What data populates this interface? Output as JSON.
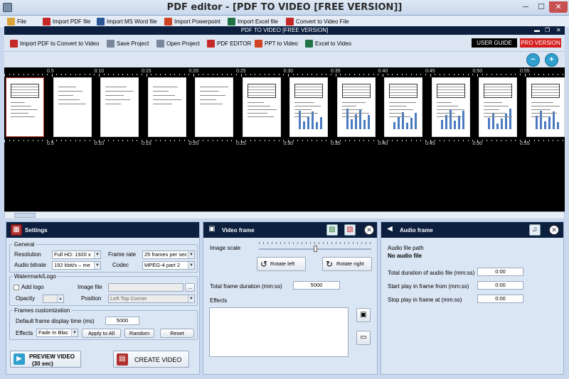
{
  "window": {
    "title": "PDF editor - [PDF TO VIDEO [FREE VERSION]]",
    "controls": {
      "minimize": "─",
      "maximize": "☐",
      "close": "✕"
    }
  },
  "menu": {
    "items": [
      {
        "label": "File",
        "icon": "folder-icon",
        "color": "#d9a53a"
      },
      {
        "label": "Import PDF file",
        "icon": "pdf-icon",
        "color": "#c62828"
      },
      {
        "label": "Import MS Word file",
        "icon": "word-icon",
        "color": "#2b5797"
      },
      {
        "label": "Import Powerpoint",
        "icon": "powerpoint-icon",
        "color": "#d04423"
      },
      {
        "label": "Import Excel file",
        "icon": "excel-icon",
        "color": "#217346"
      },
      {
        "label": "Convert to Video File",
        "icon": "video-file-icon",
        "color": "#c62828"
      }
    ]
  },
  "inner": {
    "title": "PDF TO VIDEO [FREE VERSION]",
    "controls": {
      "minimize": "▬",
      "restore": "❐",
      "close": "✕"
    }
  },
  "toolbar": {
    "items": [
      {
        "label": "Import PDF to Convert to Video",
        "icon": "import-icon",
        "color": "#c62828"
      },
      {
        "label": "Save Project",
        "icon": "save-icon",
        "color": "#7a8699"
      },
      {
        "label": "Open Project",
        "icon": "open-icon",
        "color": "#7a8699"
      },
      {
        "label": "PDF EDITOR",
        "icon": "pdf-editor-icon",
        "color": "#c62828"
      },
      {
        "label": "PPT to Video",
        "icon": "ppt-icon",
        "color": "#d04423"
      },
      {
        "label": "Excel to Video",
        "icon": "excel-icon",
        "color": "#217346"
      }
    ],
    "user_guide": "USER GUIDE",
    "pro_version": "PRO VERSION"
  },
  "timeline": {
    "ticks": [
      "0:05",
      "0:10",
      "0:15",
      "0:20",
      "0:25",
      "0:30",
      "0:35",
      "0:40",
      "0:45",
      "0:50",
      "0:55"
    ],
    "tick_labels": [
      "0.5",
      "0:10",
      "0:15",
      "0:20",
      "0:25",
      "0:30",
      "0:35",
      "0:40",
      "0:45",
      "0:50",
      "0:55"
    ]
  },
  "settings": {
    "title": "Settings",
    "general": {
      "title": "General",
      "resolution_label": "Resolution",
      "resolution_value": "Full HD: 1920 x",
      "frame_rate_label": "Frame rate",
      "frame_rate_value": "25 frames per sec",
      "audio_bitrate_label": "Audio bitrate",
      "audio_bitrate_value": "192 kbit/s – me",
      "codec_label": "Codec",
      "codec_value": "MPEG-4 part 2"
    },
    "watermark": {
      "title": "Watermark/Logo",
      "add_logo_label": "Add logo",
      "image_file_label": "Image file",
      "opacity_label": "Opacity",
      "position_label": "Position",
      "position_value": "Left Top Corner",
      "browse_label": "..."
    },
    "frames": {
      "title": "Frames customization",
      "display_time_label": "Default frame display time (ms)",
      "display_time_value": "5000",
      "effects_label": "Effects",
      "effects_value": "Fade In Blac",
      "apply_all_label": "Apply to All",
      "random_label": "Random",
      "reset_label": "Reset"
    },
    "preview_label": "PREVIEW VIDEO",
    "preview_sub": "(30 sec)",
    "create_label": "CREATE VIDEO"
  },
  "video_frame": {
    "title": "Video frame",
    "image_scale_label": "Image scale",
    "image_scale_position": 0.5,
    "rotate_left_label": "Rotate left",
    "rotate_right_label": "Rotate right",
    "duration_label": "Total frame duration (mm:ss)",
    "duration_value": "5000",
    "effects_label": "Effects"
  },
  "audio_frame": {
    "title": "Audio frame",
    "path_label": "Audio file path",
    "no_audio_label": "No audio file",
    "total_duration_label": "Total duration of audio file (mm:ss)",
    "total_duration_value": "0:00",
    "start_label": "Start play in frame from (mm:ss)",
    "start_value": "0:00",
    "stop_label": "Stop play in frame at (mm:ss)",
    "stop_value": "0:00"
  }
}
